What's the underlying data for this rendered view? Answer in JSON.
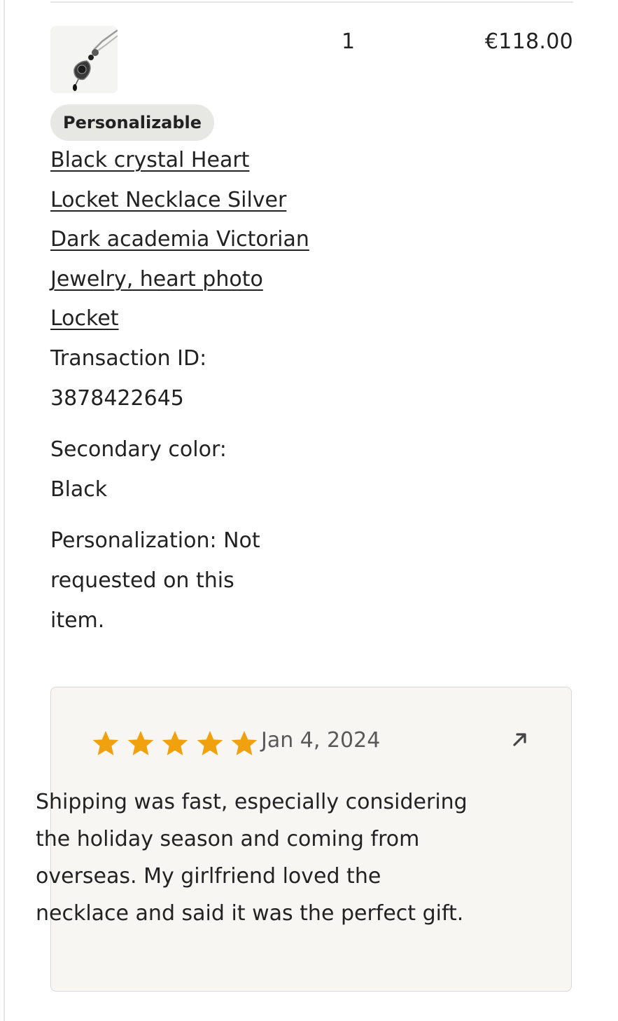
{
  "item": {
    "image_alt": "Black crystal heart locket necklace",
    "quantity": "1",
    "price": "€118.00",
    "badge": "Personalizable",
    "title": "Black crystal Heart Locket Necklace Silver Dark academia Victorian Jewelry, heart photo Locket",
    "transaction": "Transaction ID: 3878422645",
    "secondary_color": "Secondary color: Black",
    "personalization": "Personalization: Not requested on this item."
  },
  "review": {
    "rating": 5,
    "max_rating": 5,
    "star_color": "#f1a10d",
    "date": "Jan 4, 2024",
    "open_icon": "arrow-up-right-icon",
    "text": "Shipping was fast, especially considering the holiday season and coming from overseas. My girlfriend loved the necklace and said it was the perfect gift."
  }
}
